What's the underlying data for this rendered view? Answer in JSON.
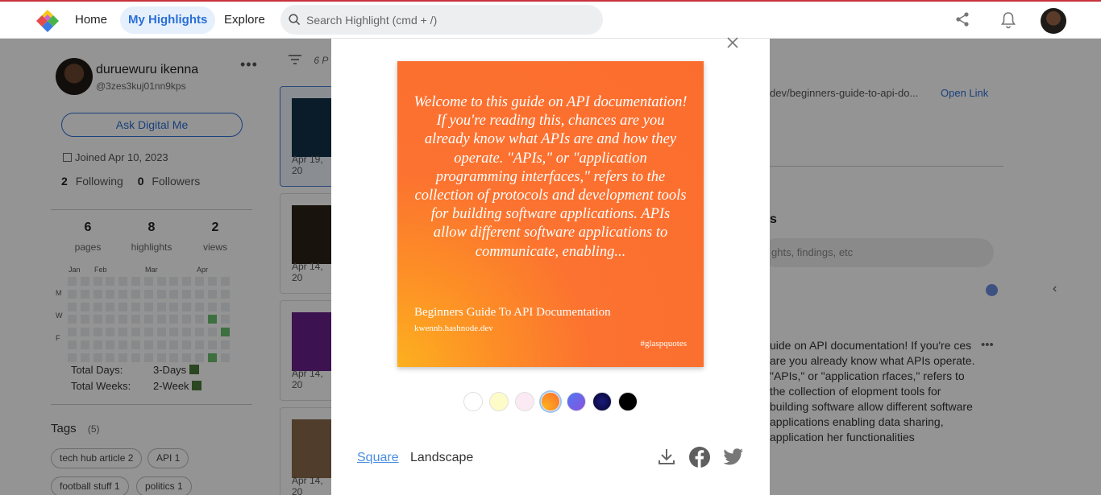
{
  "nav": {
    "home": "Home",
    "my_highlights": "My Highlights",
    "explore": "Explore",
    "search_placeholder": "Search Highlight (cmd + /)"
  },
  "profile": {
    "name": "duruewuru ikenna",
    "handle": "@3zes3kuj01nn9kps",
    "more": "•••",
    "ask_button": "Ask Digital Me",
    "joined": "Joined Apr 10, 2023",
    "following_count": "2",
    "following_label": "Following",
    "followers_count": "0",
    "followers_label": "Followers"
  },
  "stats": [
    {
      "value": "6",
      "label": "pages"
    },
    {
      "value": "8",
      "label": "highlights"
    },
    {
      "value": "2",
      "label": "views"
    }
  ],
  "heatmap": {
    "months": [
      "Jan",
      "Feb",
      "Mar",
      "Apr"
    ],
    "days": [
      "M",
      "W",
      "F"
    ],
    "active_color": "#6cc070"
  },
  "totals": {
    "days_label": "Total Days:",
    "days_value": "3-Days",
    "weeks_label": "Total Weeks:",
    "weeks_value": "2-Week"
  },
  "tags": {
    "title": "Tags",
    "count": "(5)",
    "items": [
      "tech hub article 2",
      "API 1",
      "football stuff 1",
      "politics 1"
    ]
  },
  "middle": {
    "count_text": "6 P",
    "cards": [
      {
        "date": "Apr 19, 20"
      },
      {
        "date": "Apr 14, 20"
      },
      {
        "date": "Apr 14, 20"
      },
      {
        "date": "Apr 14, 20"
      }
    ]
  },
  "right": {
    "url": "dev/beginners-guide-to-api-do...",
    "open_link": "Open Link",
    "section_letter": "s",
    "input_placeholder": "ghts, findings, etc",
    "text": "uide on API documentation! If you're ces are you already know what APIs operate. \"APIs,\" or \"application rfaces,\" refers to the collection of elopment tools for building software allow different software applications enabling data sharing, application her functionalities"
  },
  "modal": {
    "quote": "Welcome to this guide on API documentation! If you're reading this, chances are you already know what APIs are and how they operate. \"APIs,\" or \"application programming interfaces,\" refers to the collection of protocols and development tools for building software applications. APIs allow different software applications to communicate, enabling...",
    "title": "Beginners Guide To API Documentation",
    "source": "kwennb.hashnode.dev",
    "hashtag": "#glaspquotes",
    "swatches": [
      "#ffffff",
      "#fdfcc8",
      "#fbe9f3",
      "orange-gradient",
      "#6a5cf0",
      "#0a0a5a",
      "#000000"
    ],
    "selected_swatch": "orange-gradient",
    "format_square": "Square",
    "format_landscape": "Landscape"
  }
}
